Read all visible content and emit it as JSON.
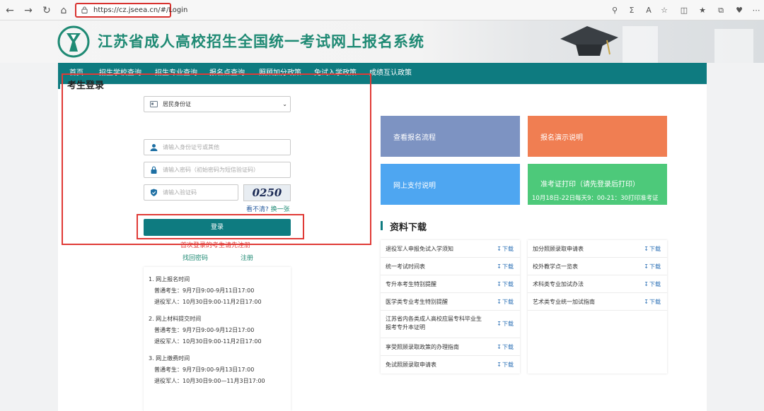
{
  "browser": {
    "url": "https://cz.jseea.cn/#/Login"
  },
  "site": {
    "title": "江苏省成人高校招生全国统一考试网上报名系统"
  },
  "nav": {
    "items": [
      "首页",
      "招生学校查询",
      "招生专业查询",
      "报名点查询",
      "照顾加分政策",
      "免试入学政策",
      "成绩互认政策"
    ]
  },
  "login": {
    "title": "考生登录",
    "id_type_value": "居民身份证",
    "id_placeholder": "请输入身份证号或其他",
    "password_placeholder": "请输入密码（初始密码为短信验证码）",
    "captcha_placeholder": "请输入验证码",
    "captcha_text": "0250",
    "refresh_prefix": "看不清?",
    "refresh_link": "换一张",
    "login_button": "登录",
    "first_login_note": "首次登录的考生请先注册",
    "find_password": "找回密码",
    "register": "注册"
  },
  "schedule": {
    "sections": [
      {
        "heading": "1. 网上报名时间",
        "lines": [
          "普通考生：9月7日9:00-9月11日17:00",
          "退役军人：10月30日9:00-11月2日17:00"
        ]
      },
      {
        "heading": "2. 网上材料提交时间",
        "lines": [
          "普通考生：9月7日9:00-9月12日17:00",
          "退役军人：10月30日9:00-11月2日17:00"
        ]
      },
      {
        "heading": "3. 网上缴费时间",
        "lines": [
          "普通考生：9月7日9:00-9月13日17:00",
          "退役军人：10月30日9:00—11月3日17:00"
        ]
      }
    ]
  },
  "tiles": {
    "process": "查看报名流程",
    "demo": "报名演示说明",
    "payment": "网上支付说明",
    "ticket_title": "准考证打印（请先登录后打印）",
    "ticket_sub": "10月18日-22日每天9：00-21：30打印准考证"
  },
  "downloads": {
    "title": "资料下载",
    "download_label": "下载",
    "left": [
      "退役军人申报免试入学须知",
      "统一考试时间表",
      "专升本考生特别提醒",
      "医学类专业考生特别提醒",
      "江苏省内各类成人高校应届专科毕业生报考专升本证明",
      "享受照顾录取政策的办理指南",
      "免试照顾录取申请表"
    ],
    "right": [
      "加分照顾录取申请表",
      "校外教学点一览表",
      "术科类专业加试办法",
      "艺术类专业统一加试指南"
    ]
  },
  "colors": {
    "teal": "#0e7b80",
    "highlight_red": "#e03a36",
    "title_green": "#1f8a74"
  }
}
